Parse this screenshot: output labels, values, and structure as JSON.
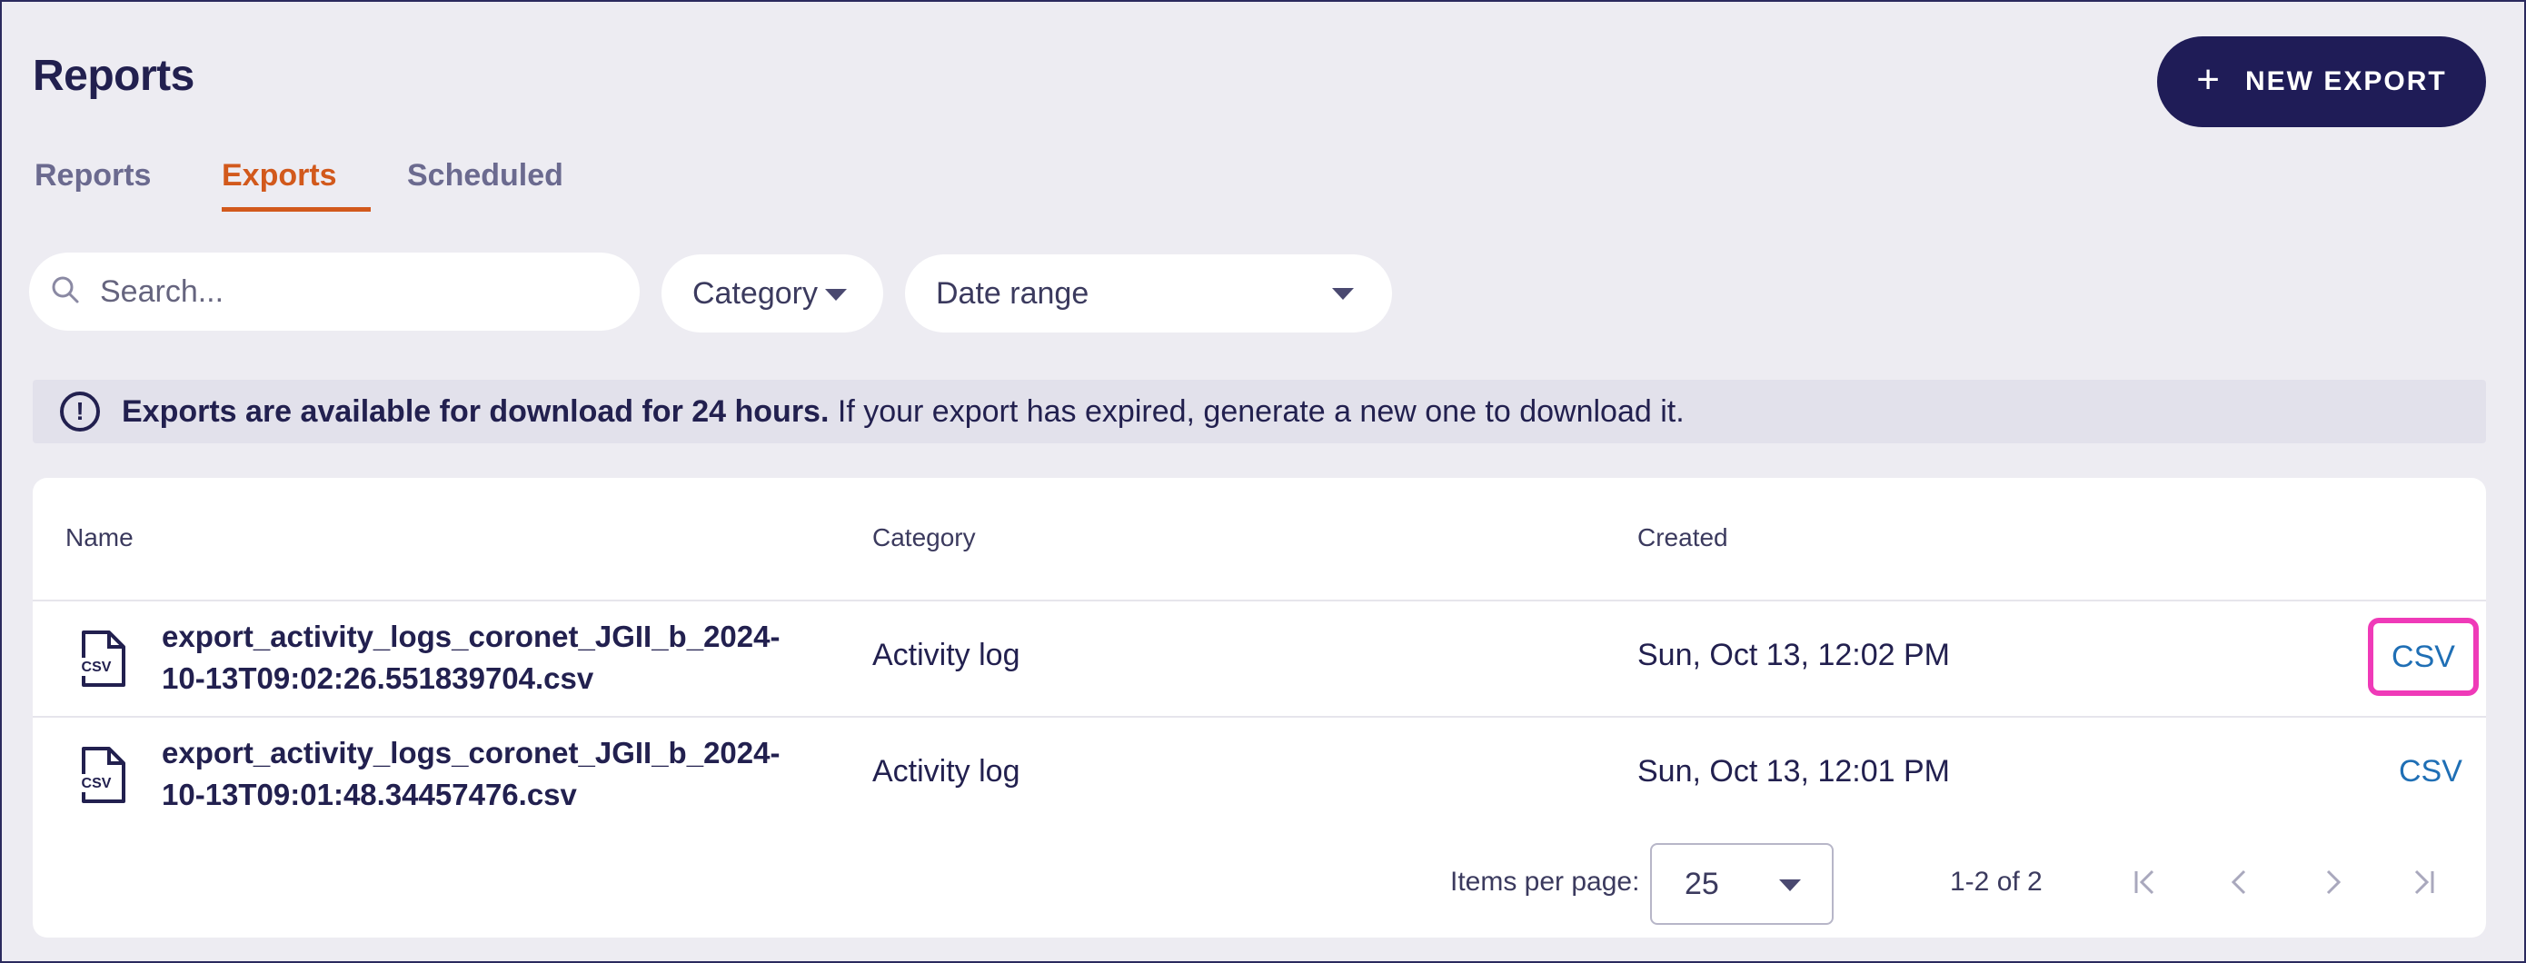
{
  "header": {
    "title": "Reports",
    "new_export_label": "NEW EXPORT",
    "new_export_icon": "plus-icon"
  },
  "tabs": [
    {
      "label": "Reports",
      "active": false
    },
    {
      "label": "Exports",
      "active": true
    },
    {
      "label": "Scheduled",
      "active": false
    }
  ],
  "filters": {
    "search_placeholder": "Search...",
    "category_label": "Category",
    "date_range_label": "Date range"
  },
  "banner": {
    "icon": "alert-circle-icon",
    "bold_text": "Exports are available for download for 24 hours.",
    "text": " If your export has expired, generate a new one to download it."
  },
  "table": {
    "columns": [
      "Name",
      "Category",
      "Created"
    ],
    "rows": [
      {
        "icon": "csv-file-icon",
        "name_line1": "export_activity_logs_coronet_JGII_b_2024-",
        "name_line2": "10-13T09:02:26.551839704.csv",
        "category": "Activity log",
        "created": "Sun, Oct 13, 12:02 PM",
        "download": "CSV"
      },
      {
        "icon": "csv-file-icon",
        "name_line1": "export_activity_logs_coronet_JGII_b_2024-",
        "name_line2": "10-13T09:01:48.34457476.csv",
        "category": "Activity log",
        "created": "Sun, Oct 13, 12:01 PM",
        "download": "CSV"
      }
    ]
  },
  "pagination": {
    "items_per_page_label": "Items per page:",
    "items_per_page_value": "25",
    "range_text": "1-2 of 2"
  },
  "colors": {
    "primary": "#1f1c57",
    "accent": "#d2591c",
    "link": "#1f6fb5",
    "highlight": "#ef3ab8"
  }
}
